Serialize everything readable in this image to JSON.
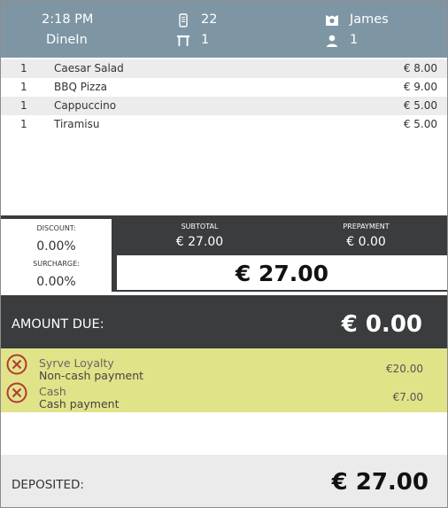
{
  "header": {
    "time": "2:18 PM",
    "order_type": "DineIn",
    "guests": "22",
    "table": "1",
    "waiter": "James",
    "persons": "1"
  },
  "items": [
    {
      "qty": "1",
      "name": "Caesar Salad",
      "price": "€ 8.00"
    },
    {
      "qty": "1",
      "name": "BBQ Pizza",
      "price": "€ 9.00"
    },
    {
      "qty": "1",
      "name": "Cappuccino",
      "price": "€ 5.00"
    },
    {
      "qty": "1",
      "name": "Tiramisu",
      "price": "€ 5.00"
    }
  ],
  "totals": {
    "discount_label": "DISCOUNT:",
    "discount_value": "0.00%",
    "surcharge_label": "SURCHARGE:",
    "surcharge_value": "0.00%",
    "subtotal_label": "SUBTOTAL",
    "subtotal_value": "€ 27.00",
    "prepayment_label": "PREPAYMENT",
    "prepayment_value": "€ 0.00",
    "total_value": "€ 27.00"
  },
  "amount_due": {
    "label": "AMOUNT DUE:",
    "value": "€ 0.00"
  },
  "payments": [
    {
      "name": "Syrve Loyalty",
      "type": "Non-cash payment",
      "amount": "€20.00"
    },
    {
      "name": "Cash",
      "type": "Cash payment",
      "amount": "€7.00"
    }
  ],
  "deposited": {
    "label": "DEPOSITED:",
    "value": "€ 27.00"
  },
  "colors": {
    "header_bg": "#7e96a4",
    "dark_panel": "#3a3c3d",
    "payments_bg": "#e1e388",
    "remove_icon": "#b03a3a"
  },
  "icons": {
    "guests": "phone-icon",
    "table": "table-icon",
    "waiter": "waiter-icon",
    "persons": "person-icon",
    "remove": "remove-circle-icon"
  }
}
